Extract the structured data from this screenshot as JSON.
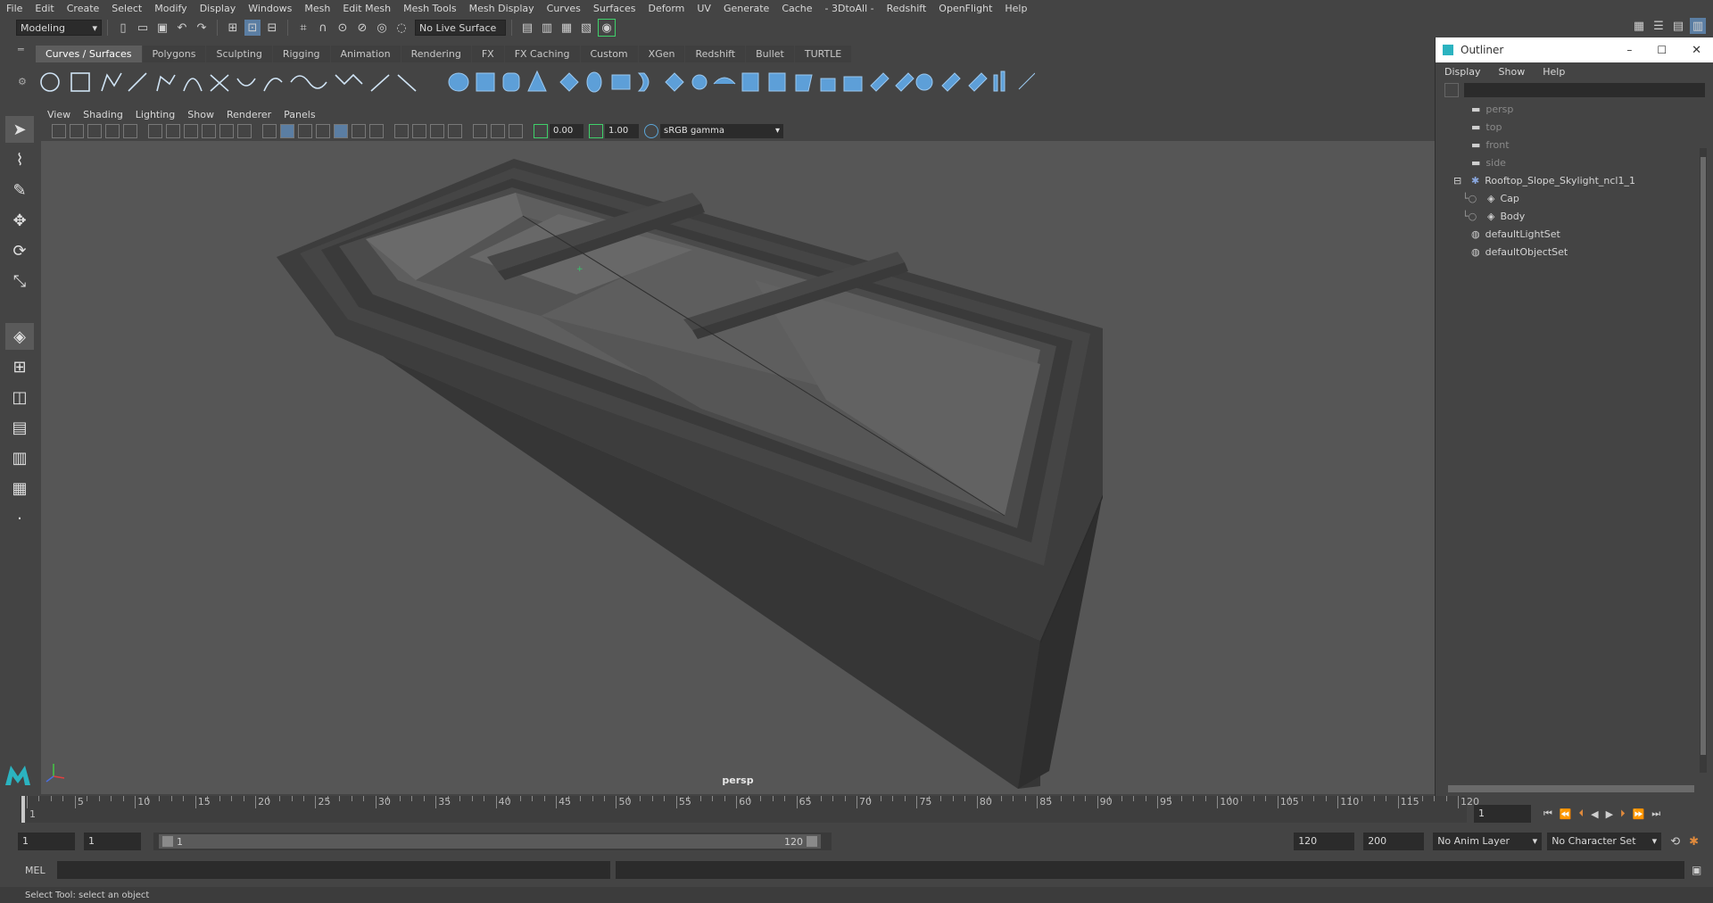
{
  "menubar": {
    "items": [
      "File",
      "Edit",
      "Create",
      "Select",
      "Modify",
      "Display",
      "Windows",
      "Mesh",
      "Edit Mesh",
      "Mesh Tools",
      "Mesh Display",
      "Curves",
      "Surfaces",
      "Deform",
      "UV",
      "Generate",
      "Cache",
      "- 3DtoAll -",
      "Redshift",
      "OpenFlight",
      "Help"
    ]
  },
  "statusline": {
    "workspace": "Modeling",
    "live_surface": "No Live Surface"
  },
  "shelf": {
    "tabs": [
      "Curves / Surfaces",
      "Polygons",
      "Sculpting",
      "Rigging",
      "Animation",
      "Rendering",
      "FX",
      "FX Caching",
      "Custom",
      "XGen",
      "Redshift",
      "Bullet",
      "TURTLE"
    ],
    "active_tab": "Curves / Surfaces"
  },
  "viewport": {
    "menus": [
      "View",
      "Shading",
      "Lighting",
      "Show",
      "Renderer",
      "Panels"
    ],
    "exposure": "0.00",
    "gamma": "1.00",
    "color_space": "sRGB gamma",
    "camera": "persp"
  },
  "outliner": {
    "title": "Outliner",
    "menus": [
      "Display",
      "Show",
      "Help"
    ],
    "items": [
      {
        "label": "persp",
        "icon": "camera-icon",
        "indent": 0,
        "dim": true
      },
      {
        "label": "top",
        "icon": "camera-icon",
        "indent": 0,
        "dim": true
      },
      {
        "label": "front",
        "icon": "camera-icon",
        "indent": 0,
        "dim": true
      },
      {
        "label": "side",
        "icon": "camera-icon",
        "indent": 0,
        "dim": true
      },
      {
        "label": "Rooftop_Slope_Skylight_ncl1_1",
        "icon": "transform-group-icon",
        "indent": 0,
        "dim": false,
        "expanded": true
      },
      {
        "label": "Cap",
        "icon": "mesh-icon",
        "indent": 1,
        "dim": false
      },
      {
        "label": "Body",
        "icon": "mesh-icon",
        "indent": 1,
        "dim": false
      },
      {
        "label": "defaultLightSet",
        "icon": "set-icon",
        "indent": 0,
        "dim": false
      },
      {
        "label": "defaultObjectSet",
        "icon": "set-icon",
        "indent": 0,
        "dim": false
      }
    ]
  },
  "timeline": {
    "ticks": [
      1,
      5,
      10,
      15,
      20,
      25,
      30,
      35,
      40,
      45,
      50,
      55,
      60,
      65,
      70,
      75,
      80,
      85,
      90,
      95,
      100,
      105,
      110,
      115,
      120
    ],
    "current_frame": "1"
  },
  "range": {
    "start": "1",
    "playback_start": "1",
    "slider_start": "1",
    "slider_end": "120",
    "playback_end": "120",
    "end": "200",
    "anim_layer": "No Anim Layer",
    "character_set": "No Character Set"
  },
  "cmdline": {
    "label": "MEL"
  },
  "helpline": {
    "text": "Select Tool: select an object"
  }
}
